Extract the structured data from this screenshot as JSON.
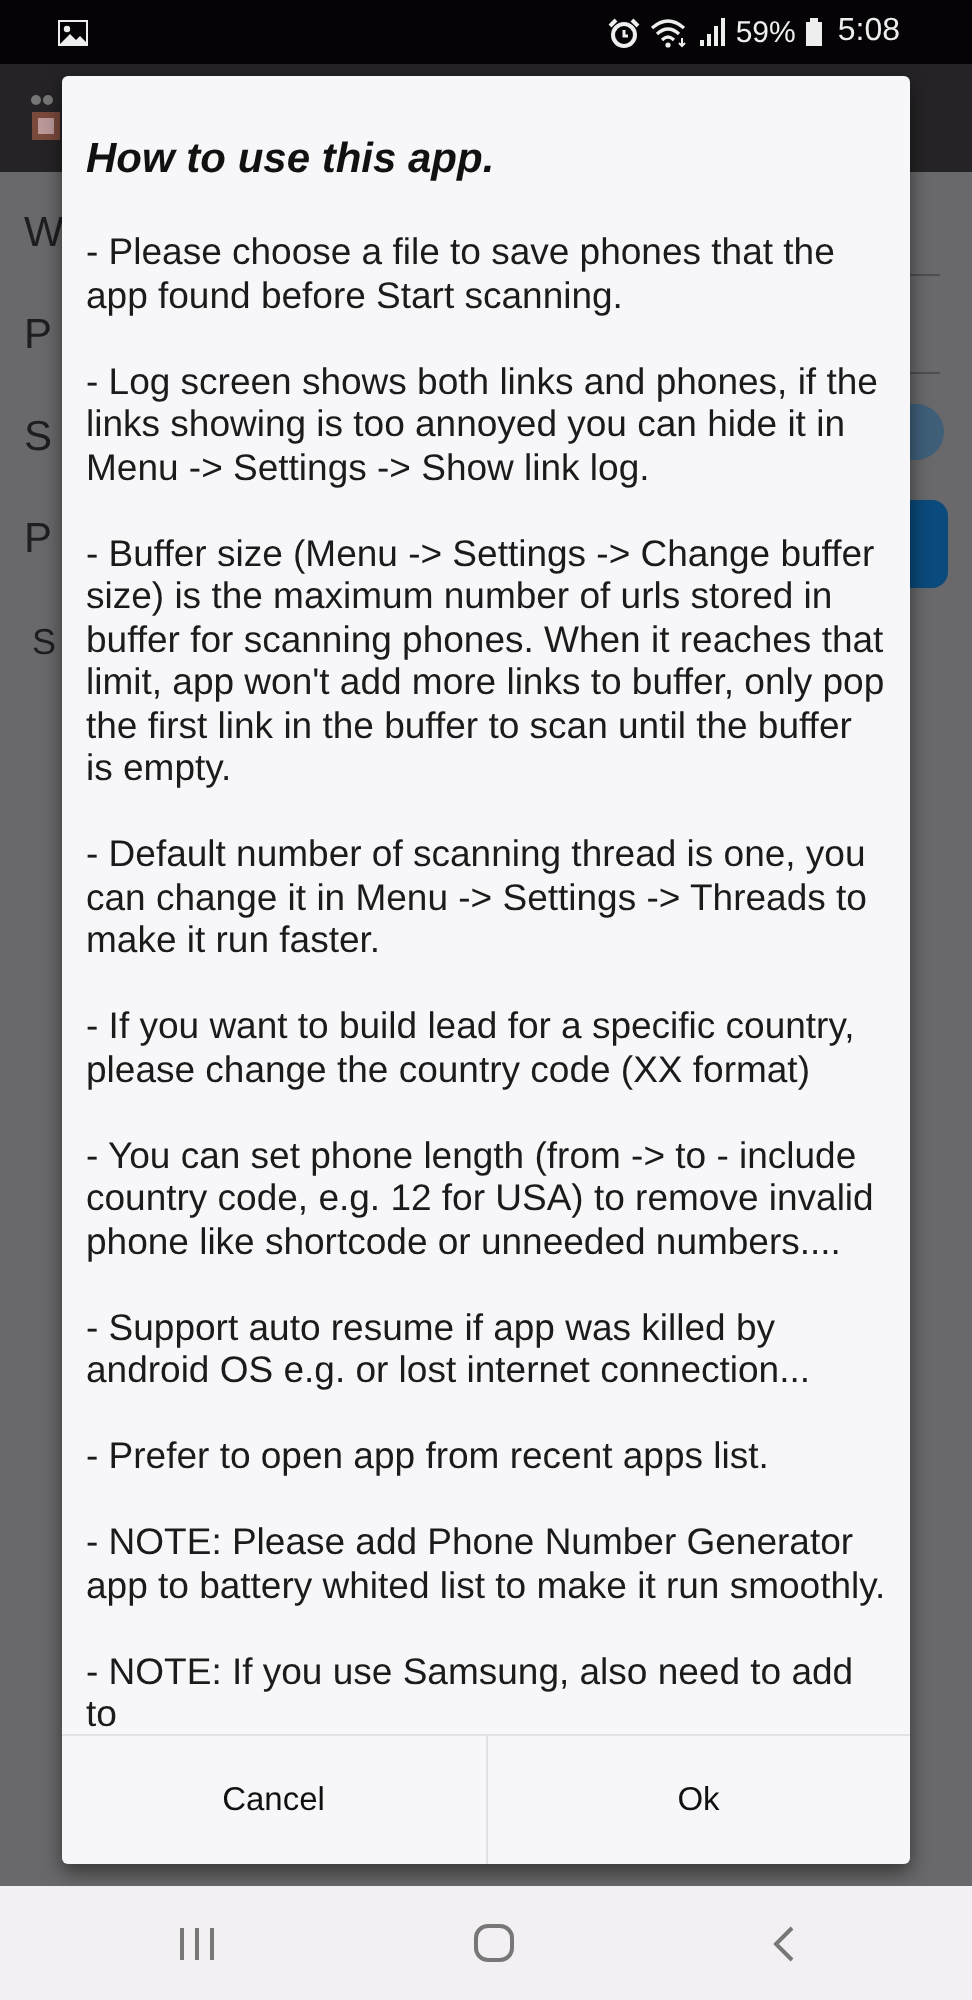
{
  "status_bar": {
    "battery": "59%",
    "time": "5:08"
  },
  "background": {
    "labels": [
      "W",
      "P",
      "S",
      "P",
      "S"
    ]
  },
  "dialog": {
    "title": "How to use this app.",
    "paragraphs": [
      "- Please choose a file to save phones that the app found before Start scanning.",
      "- Log screen shows both links and phones, if the links showing is too annoyed you can hide it in Menu -> Settings -> Show link log.",
      "- Buffer size (Menu -> Settings -> Change buffer size) is the maximum number of urls stored in buffer for scanning phones. When it reaches that limit, app won't add more links to buffer, only pop the first link in the buffer to scan until the buffer is empty.",
      "- Default number of scanning thread is one, you can change it in Menu -> Settings -> Threads to make it run faster.",
      "- If you want to build lead for a specific country, please change the country code (XX format)",
      "- You can set phone length (from -> to - include country code, e.g. 12 for USA) to remove invalid phone like shortcode or unneeded numbers....",
      "- Support auto resume if app was killed by android OS e.g. or lost internet connection...",
      "- Prefer to open app from recent apps list.",
      "- NOTE: Please add Phone Number Generator app to battery whited list to make it run smoothly.",
      "- NOTE: If you use Samsung, also need to add to"
    ],
    "buttons": [
      "Cancel",
      "Ok"
    ]
  }
}
